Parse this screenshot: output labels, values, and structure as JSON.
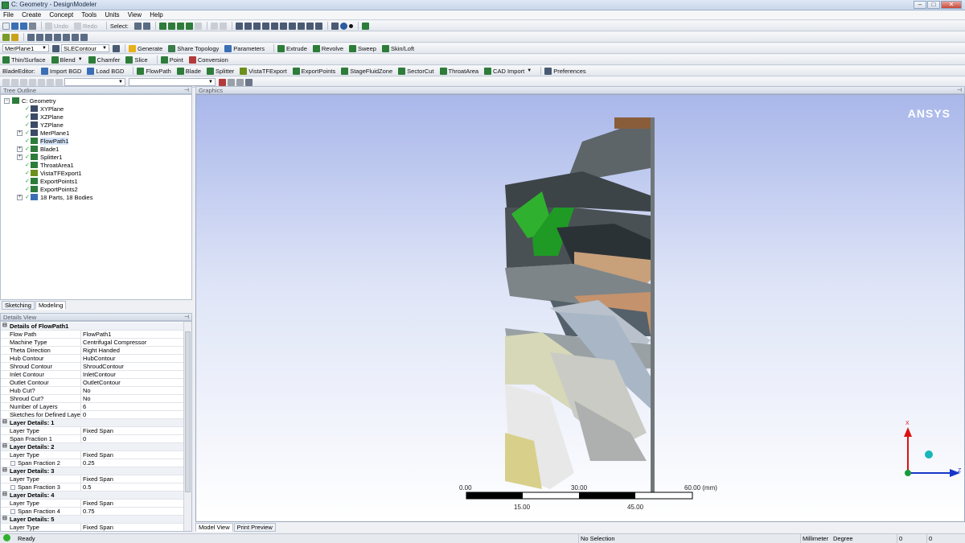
{
  "window": {
    "title": "C: Geometry - DesignModeler"
  },
  "menu": [
    "File",
    "Create",
    "Concept",
    "Tools",
    "Units",
    "View",
    "Help"
  ],
  "toolbar1": {
    "undo": "Undo",
    "redo": "Redo",
    "select_label": "Select:"
  },
  "toolbar3": {
    "plane_value": "MerPlane1",
    "sketch_value": "SLEContour",
    "generate": "Generate",
    "share_topology": "Share Topology",
    "parameters": "Parameters",
    "extrude": "Extrude",
    "revolve": "Revolve",
    "sweep": "Sweep",
    "skin_loft": "Skin/Loft"
  },
  "toolbar4": {
    "thin_surface": "Thin/Surface",
    "blend": "Blend",
    "chamfer": "Chamfer",
    "slice": "Slice",
    "point": "Point",
    "conversion": "Conversion"
  },
  "toolbar5": {
    "blade_editor": "BladeEditor:",
    "import_bgd": "Import BGD",
    "load_bgd": "Load BGD",
    "flowpath": "FlowPath",
    "blade": "Blade",
    "splitter": "Splitter",
    "vista_tf_export": "VistaTFExport",
    "export_points": "ExportPoints",
    "stage_fluid_zone": "StageFluidZone",
    "sector_cut": "SectorCut",
    "throat_area": "ThroatArea",
    "cad_import": "CAD Import",
    "preferences": "Preferences"
  },
  "tree": {
    "title": "Tree Outline",
    "items": [
      {
        "label": "C: Geometry"
      },
      {
        "label": "XYPlane"
      },
      {
        "label": "XZPlane"
      },
      {
        "label": "YZPlane"
      },
      {
        "label": "MerPlane1"
      },
      {
        "label": "FlowPath1"
      },
      {
        "label": "Blade1"
      },
      {
        "label": "Splitter1"
      },
      {
        "label": "ThroatArea1"
      },
      {
        "label": "VistaTFExport1"
      },
      {
        "label": "ExportPoints1"
      },
      {
        "label": "ExportPoints2"
      },
      {
        "label": "18 Parts, 18 Bodies"
      }
    ]
  },
  "left_tabs": {
    "sketching": "Sketching",
    "modeling": "Modeling"
  },
  "details": {
    "title": "Details View",
    "rows": [
      {
        "k": "Details of FlowPath1",
        "v": ""
      },
      {
        "k": "Flow Path",
        "v": "FlowPath1"
      },
      {
        "k": "Machine Type",
        "v": "Centrifugal Compressor"
      },
      {
        "k": "Theta Direction",
        "v": "Right Handed"
      },
      {
        "k": "Hub Contour",
        "v": "HubContour"
      },
      {
        "k": "Shroud Contour",
        "v": "ShroudContour"
      },
      {
        "k": "Inlet Contour",
        "v": "InletContour"
      },
      {
        "k": "Outlet Contour",
        "v": "OutletContour"
      },
      {
        "k": "Hub Cut?",
        "v": "No"
      },
      {
        "k": "Shroud Cut?",
        "v": "No"
      },
      {
        "k": "Number of Layers",
        "v": "6"
      },
      {
        "k": "Sketches for Defined Layer",
        "v": "0"
      },
      {
        "k": "Layer Details: 1",
        "v": ""
      },
      {
        "k": "Layer Type",
        "v": "Fixed Span"
      },
      {
        "k": "Span Fraction 1",
        "v": "0"
      },
      {
        "k": "Layer Details: 2",
        "v": ""
      },
      {
        "k": "Layer Type",
        "v": "Fixed Span"
      },
      {
        "k": "Span Fraction 2",
        "v": "0.25"
      },
      {
        "k": "Layer Details: 3",
        "v": ""
      },
      {
        "k": "Layer Type",
        "v": "Fixed Span"
      },
      {
        "k": "Span Fraction 3",
        "v": "0.5"
      },
      {
        "k": "Layer Details: 4",
        "v": ""
      },
      {
        "k": "Layer Type",
        "v": "Fixed Span"
      },
      {
        "k": "Span Fraction 4",
        "v": "0.75"
      },
      {
        "k": "Layer Details: 5",
        "v": ""
      },
      {
        "k": "Layer Type",
        "v": "Fixed Span"
      }
    ]
  },
  "graphics": {
    "title": "Graphics",
    "logo": "ANSYS",
    "scale": {
      "top": [
        "0.00",
        "30.00",
        "60.00 (mm)"
      ],
      "bottom": [
        "15.00",
        "45.00"
      ]
    },
    "axis": {
      "x": "X",
      "z": "Z"
    }
  },
  "graphics_tabs": {
    "model_view": "Model View",
    "print_preview": "Print Preview"
  },
  "status": {
    "ready": "Ready",
    "selection": "No Selection",
    "length_unit": "Millimeter",
    "angle_unit": "Degree",
    "val1": "0",
    "val2": "0"
  },
  "colors": {
    "accent_green": "#2fb12f",
    "axis_red": "#d11",
    "axis_blue": "#1636c8"
  }
}
